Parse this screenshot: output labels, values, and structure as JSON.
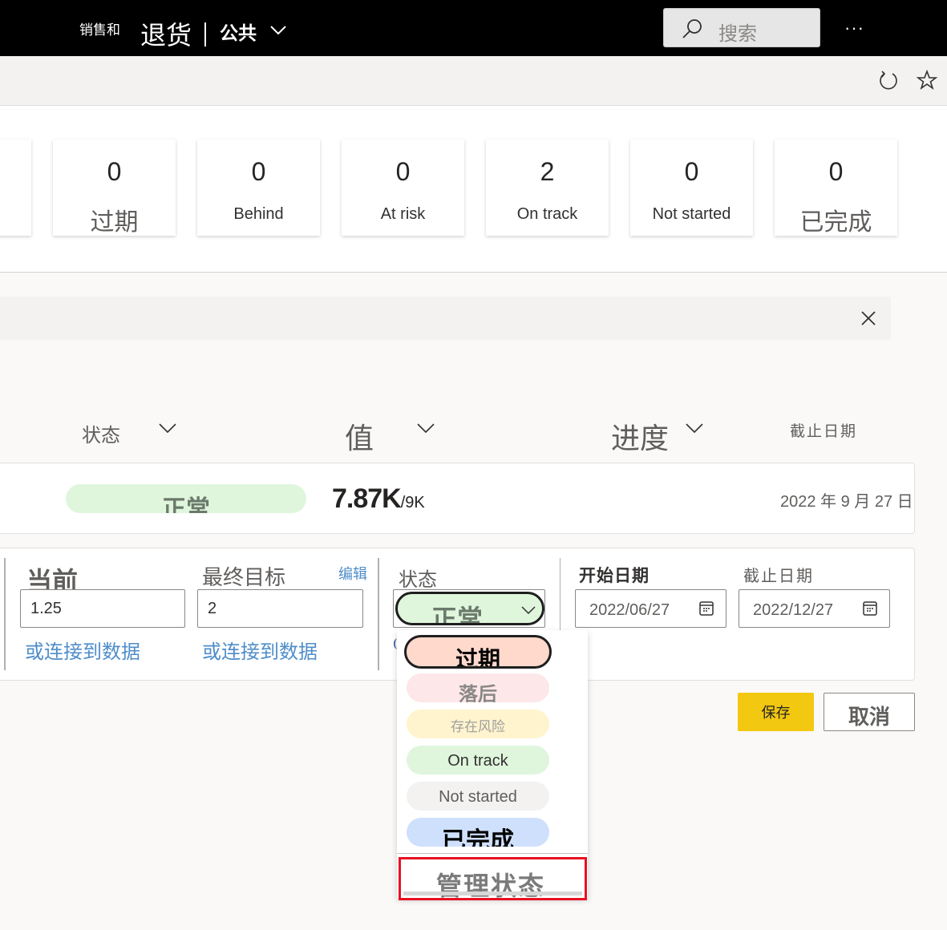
{
  "topbar": {
    "brand_prefix": "销售和",
    "brand_main": "退货",
    "workspace": "公共",
    "search_placeholder": "搜索",
    "more_label": "···"
  },
  "summary": {
    "cards": [
      {
        "value": "0",
        "label": "过期"
      },
      {
        "value": "0",
        "label": "Behind"
      },
      {
        "value": "0",
        "label": "At risk"
      },
      {
        "value": "2",
        "label": "On track"
      },
      {
        "value": "0",
        "label": "Not started"
      },
      {
        "value": "0",
        "label": "已完成"
      }
    ]
  },
  "columns": {
    "status": "状态",
    "value": "值",
    "progress": "进度",
    "due_date": "截止日期"
  },
  "goal": {
    "status": "正常",
    "current_value": "7.87K",
    "target_value": "/9K",
    "due_date": "2022 年 9 月 27 日"
  },
  "edit": {
    "current_label": "当前",
    "current_value": "1.25",
    "target_label": "最终目标",
    "target_value": "2",
    "edit_link": "编辑",
    "connect_link": "或连接到数据",
    "status_label": "状态",
    "status_value": "正常",
    "start_label": "开始日期",
    "start_value": "2022/06/27",
    "due_label": "截止日期",
    "due_value": "2022/12/27",
    "save": "保存",
    "cancel": "取消"
  },
  "status_dropdown": {
    "options": [
      {
        "label": "过期",
        "color": "#fed9cc"
      },
      {
        "label": "落后",
        "color": "#fde7e9"
      },
      {
        "label": "存在风险",
        "color": "#fff4ce"
      },
      {
        "label": "On track",
        "color": "#dff6dd"
      },
      {
        "label": "Not started",
        "color": "#f3f2f1"
      },
      {
        "label": "已完成",
        "color": "#cfe0fc"
      }
    ],
    "manage": "管理状态"
  },
  "colors": {
    "accent_yellow": "#f2c811",
    "link_blue": "#4f8dc9",
    "highlight_red": "#e81123"
  }
}
